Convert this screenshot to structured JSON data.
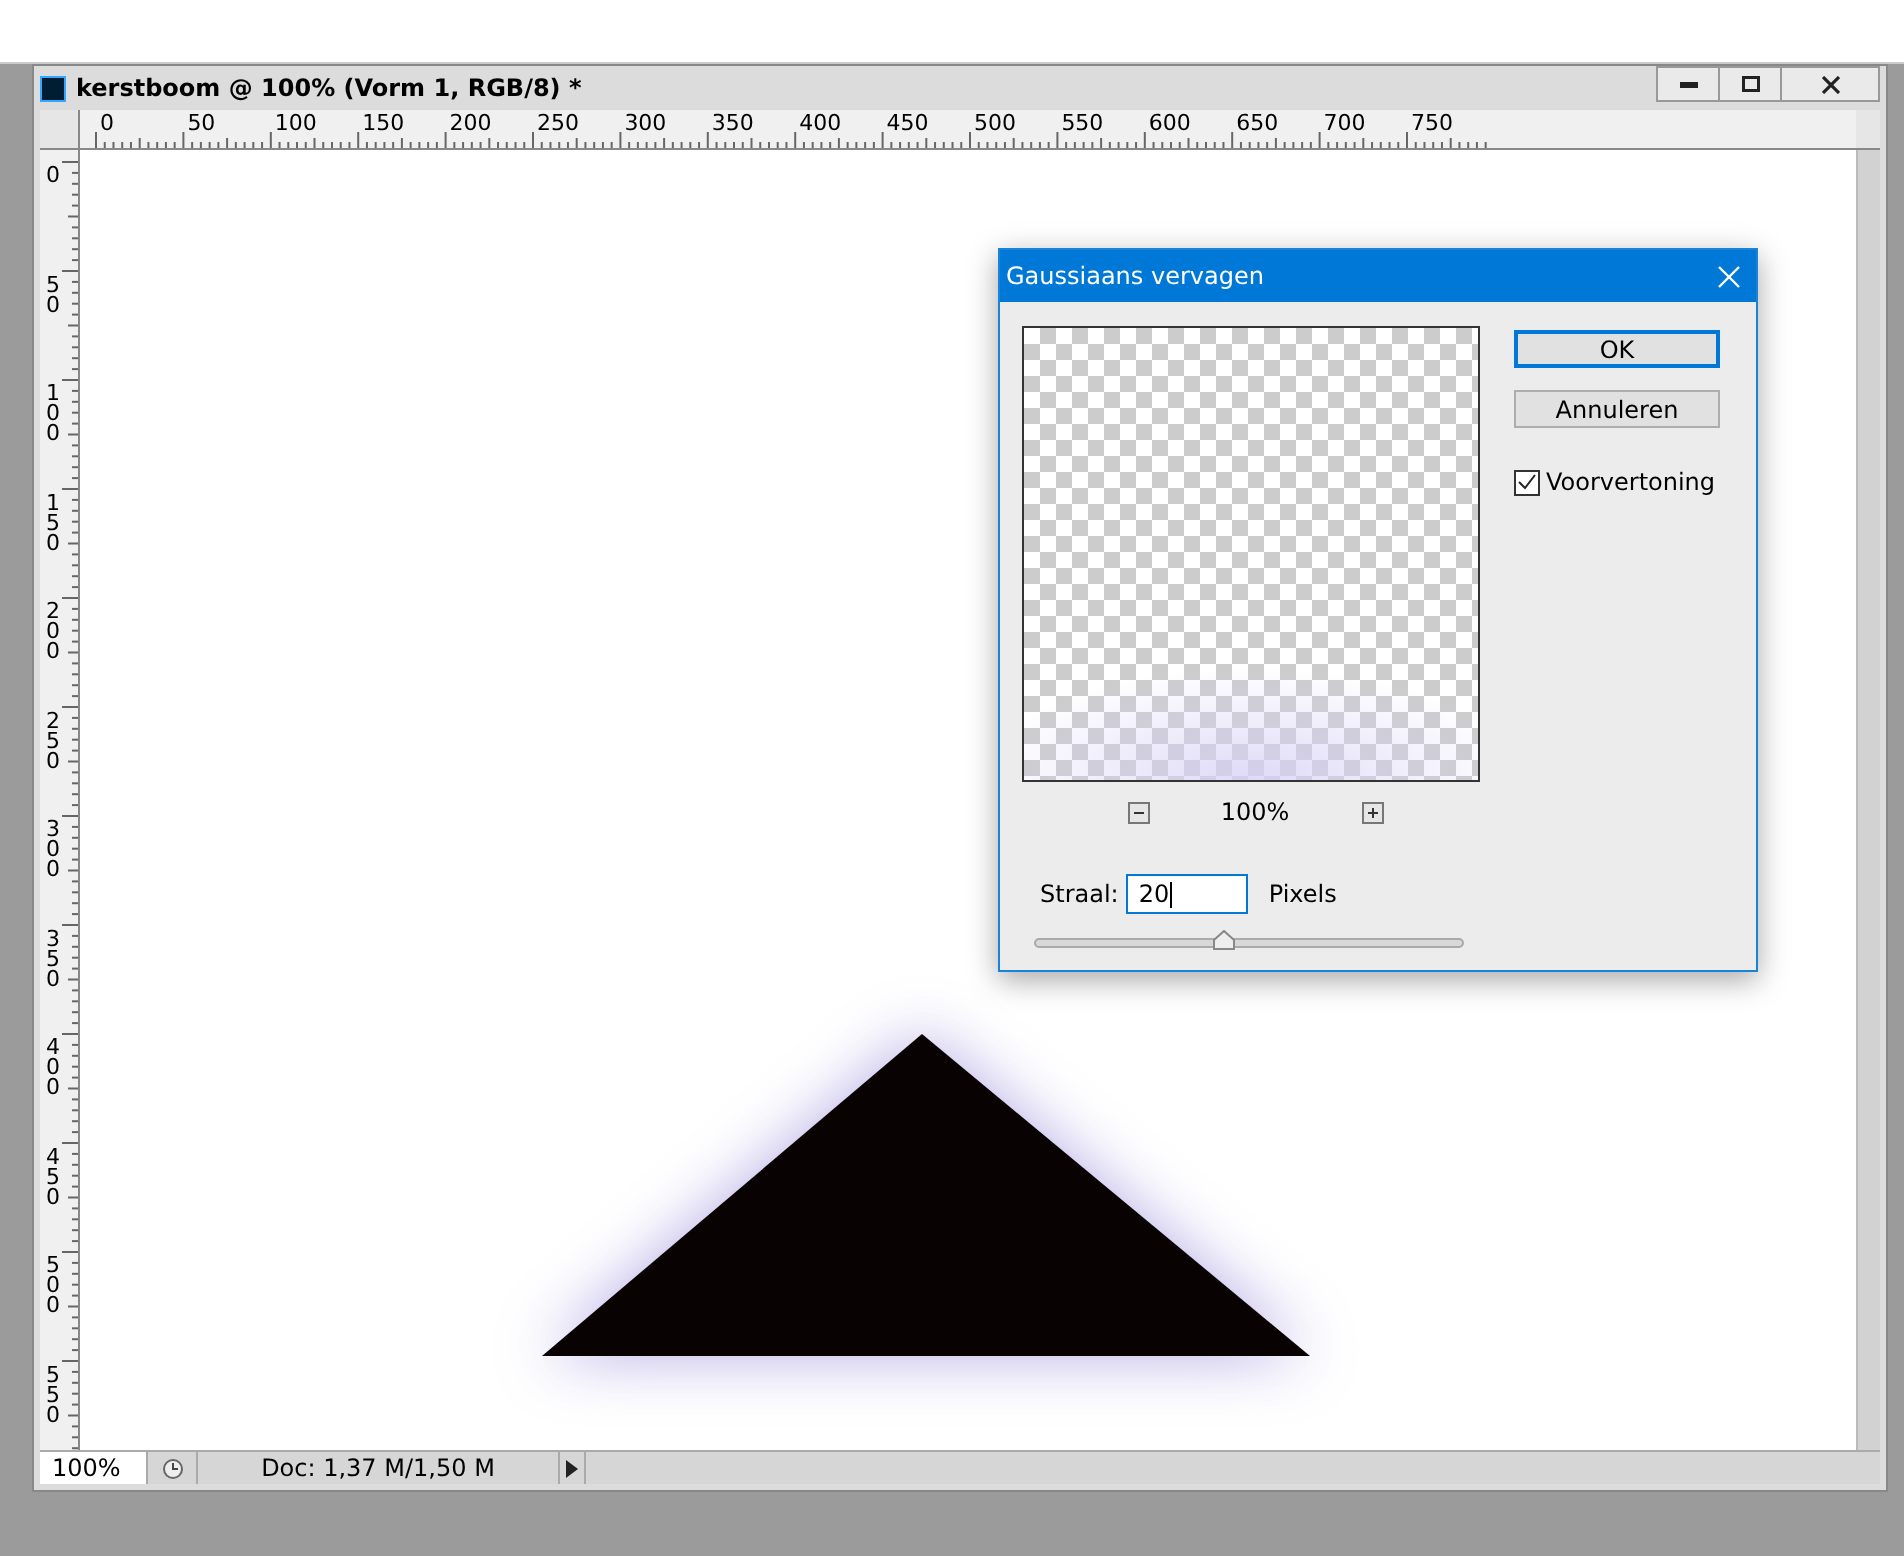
{
  "window": {
    "title": "kerstboom @ 100% (Vorm 1, RGB/8) *"
  },
  "rulers": {
    "horizontal": [
      "0",
      "50",
      "100",
      "150",
      "200",
      "250",
      "300",
      "350",
      "400",
      "450",
      "500",
      "550",
      "600",
      "650",
      "700",
      "750"
    ],
    "vertical": [
      "0",
      "50",
      "100",
      "150",
      "200",
      "250",
      "300",
      "350",
      "400",
      "450",
      "500",
      "550"
    ]
  },
  "dialog": {
    "title": "Gaussiaans vervagen",
    "buttons": [
      {
        "label": "OK",
        "default": true
      },
      {
        "label": "Annuleren",
        "default": false
      }
    ],
    "preview": {
      "label": "Voorvertoning",
      "checked": true
    },
    "zoom": "100%",
    "radius": {
      "label": "Straal:",
      "value": "20",
      "unit": "Pixels",
      "level": 0.44
    }
  },
  "status_bar": {
    "zoom": "100%",
    "doc": "Doc: 1,37 M/1,50 M"
  }
}
